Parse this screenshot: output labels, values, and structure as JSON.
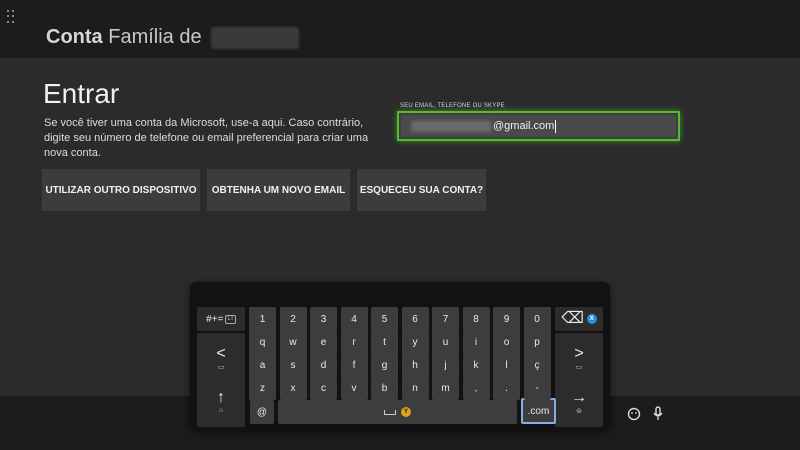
{
  "header": {
    "title_bold": "Conta",
    "title_rest": "Família de"
  },
  "signin": {
    "title": "Entrar",
    "description": "Se você tiver uma conta da Microsoft, use-a aqui. Caso contrário, digite seu número de telefone ou email preferencial para criar uma nova conta.",
    "field_label": "SEU EMAIL, TELEFONE OU SKYPE",
    "field_value_visible": "@gmail.com"
  },
  "actions": [
    {
      "label": "UTILIZAR OUTRO DISPOSITIVO"
    },
    {
      "label": "OBTENHA UM NOVO EMAIL"
    },
    {
      "label": "ESQUECEU SUA CONTA?"
    }
  ],
  "keyboard": {
    "symbols_label": "#+=",
    "symbols_badge": "LT",
    "digits": [
      "1",
      "2",
      "3",
      "4",
      "5",
      "6",
      "7",
      "8",
      "9",
      "0"
    ],
    "row2": [
      "q",
      "w",
      "e",
      "r",
      "t",
      "y",
      "u",
      "i",
      "o",
      "p"
    ],
    "row3": [
      "a",
      "s",
      "d",
      "f",
      "g",
      "h",
      "j",
      "k",
      "l",
      "ç"
    ],
    "row4": [
      "z",
      "x",
      "c",
      "v",
      "b",
      "n",
      "m",
      ",",
      ".",
      "-"
    ],
    "at_key": "@",
    "dotcom_key": ".com",
    "backspace_badge": "X",
    "space_badge": "Y",
    "prev_glyph": "<",
    "next_glyph": ">",
    "shift_glyph": "↑",
    "enter_glyph": "→",
    "colors": {
      "x_button": "#2a8fd8",
      "y_button": "#e0a020",
      "focus_border": "#86aee6",
      "field_glow": "#4fbf2e"
    }
  }
}
